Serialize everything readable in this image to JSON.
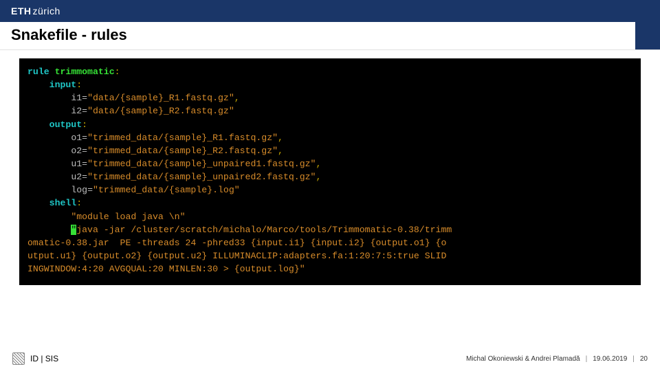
{
  "brand": {
    "name": "ETH",
    "suffix": "zürich"
  },
  "slide": {
    "title": "Snakefile - rules"
  },
  "code": {
    "kw_rule": "rule",
    "rule_name": "trimmomatic",
    "kw_input": "input",
    "i1_name": "i1",
    "i1_val": "\"data/{sample}_R1.fastq.gz\"",
    "i2_name": "i2",
    "i2_val": "\"data/{sample}_R2.fastq.gz\"",
    "kw_output": "output",
    "o1_name": "o1",
    "o1_val": "\"trimmed_data/{sample}_R1.fastq.gz\"",
    "o2_name": "o2",
    "o2_val": "\"trimmed_data/{sample}_R2.fastq.gz\"",
    "u1_name": "u1",
    "u1_val": "\"trimmed_data/{sample}_unpaired1.fastq.gz\"",
    "u2_name": "u2",
    "u2_val": "\"trimmed_data/{sample}_unpaired2.fastq.gz\"",
    "log_name": "log",
    "log_val": "\"trimmed_data/{sample}.log\"",
    "kw_shell": "shell",
    "sh1": "\"module load java \\n\"",
    "sh2a": "\"",
    "sh2b": "java -jar /cluster/scratch/michalo/Marco/tools/Trimmomatic-0.38/trimm",
    "sh3": "omatic-0.38.jar  PE -threads 24 -phred33 {input.i1} {input.i2} {output.o1} {o",
    "sh4": "utput.u1} {output.o2} {output.u2} ILLUMINACLIP:adapters.fa:1:20:7:5:true SLID",
    "sh5": "INGWINDOW:4:20 AVGQUAL:20 MINLEN:30 > {output.log}\""
  },
  "footer": {
    "dept": "ID | SIS",
    "authors": "Michal Okoniewski & Andrei Plamadă",
    "date": "19.06.2019",
    "page": "20"
  }
}
